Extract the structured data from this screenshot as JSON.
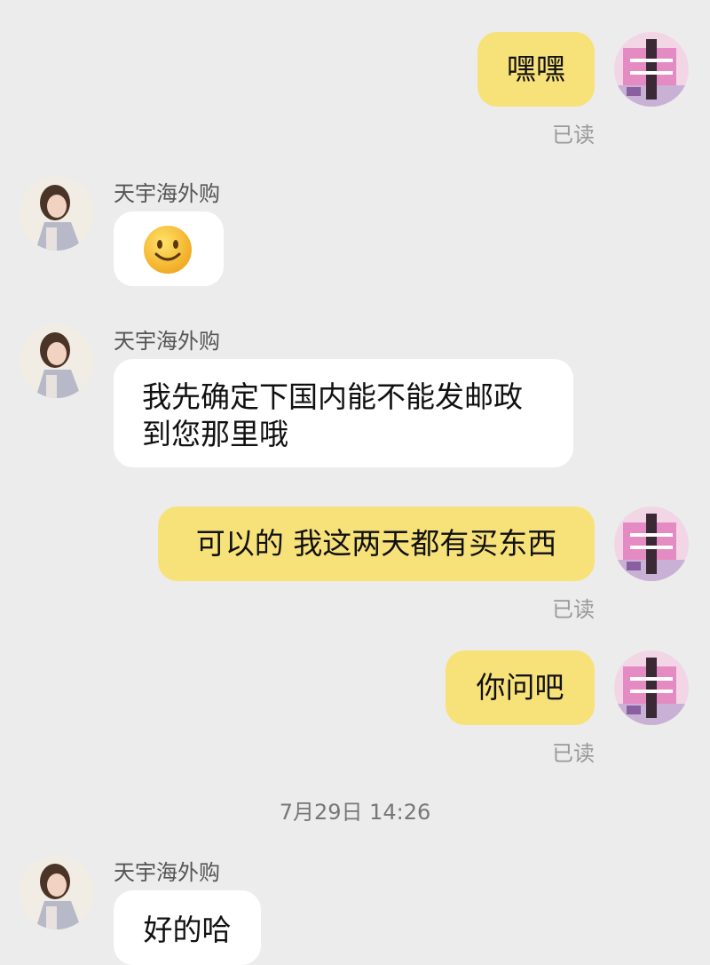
{
  "messages": [
    {
      "side": "me",
      "text": "嘿嘿",
      "status": "已读"
    },
    {
      "side": "them",
      "sender": "天宇海外购",
      "emoji": "slightly-smiling-face"
    },
    {
      "side": "them",
      "sender": "天宇海外购",
      "text": "我先确定下国内能不能发邮政到您那里哦"
    },
    {
      "side": "me",
      "text": "可以的 我这两天都有买东西",
      "status": "已读"
    },
    {
      "side": "me",
      "text": "你问吧",
      "status": "已读"
    },
    {
      "side": "divider",
      "timestamp": "7月29日 14:26"
    },
    {
      "side": "them",
      "sender": "天宇海外购",
      "text": "好的哈"
    }
  ],
  "colors": {
    "background": "#ececec",
    "my_bubble": "#f7e27a",
    "their_bubble": "#ffffff",
    "read_text": "#999999"
  },
  "icons": {
    "my_avatar": "pink-collage-avatar",
    "their_avatar": "woman-photo-avatar"
  }
}
